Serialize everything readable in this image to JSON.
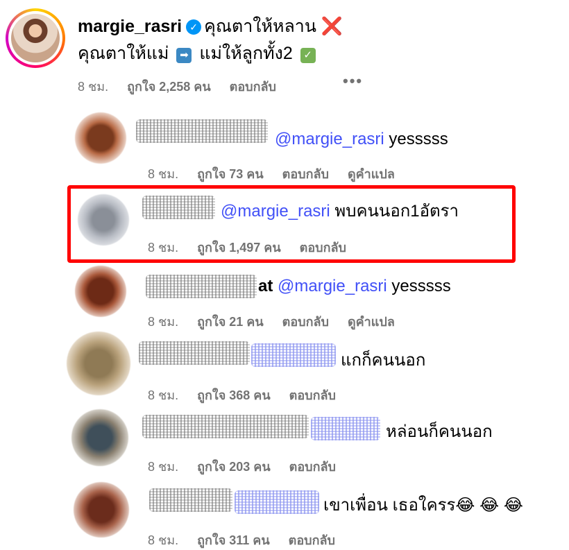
{
  "main_comment": {
    "username": "margie_rasri",
    "text_line1": "คุณตาให้หลาน",
    "line1_emoji": "❌",
    "text_line2_part1": "คุณตาให้แม่",
    "line2_arrow_emoji": "➡",
    "text_line2_part2": "แม่ให้ลูกทั้ง2",
    "line2_check_emoji": "✓",
    "time": "8 ชม.",
    "likes": "ถูกใจ 2,258 คน",
    "reply_label": "ตอบกลับ",
    "more": "•••"
  },
  "replies": [
    {
      "mention": "@margie_rasri",
      "text": "yesssss",
      "time": "8 ชม.",
      "likes": "ถูกใจ 73 คน",
      "reply_label": "ตอบกลับ",
      "translate_label": "ดูคำแปล"
    },
    {
      "mention": "@margie_rasri",
      "text": "พบคนนอก1อัตรา",
      "time": "8 ชม.",
      "likes": "ถูกใจ 1,497 คน",
      "reply_label": "ตอบกลับ",
      "highlighted": true
    },
    {
      "name_fragment": "at",
      "mention": "@margie_rasri",
      "text": "yesssss",
      "time": "8 ชม.",
      "likes": "ถูกใจ 21 คน",
      "reply_label": "ตอบกลับ",
      "translate_label": "ดูคำแปล"
    },
    {
      "text": "แกก็คนนอก",
      "time": "8 ชม.",
      "likes": "ถูกใจ 368 คน",
      "reply_label": "ตอบกลับ"
    },
    {
      "text": "หล่อนก็คนนอก",
      "time": "8 ชม.",
      "likes": "ถูกใจ 203 คน",
      "reply_label": "ตอบกลับ"
    },
    {
      "text": "เขาเพื่อน เธอใครร",
      "emoji": "😂 😂 😂",
      "time": "8 ชม.",
      "likes": "ถูกใจ 311 คน",
      "reply_label": "ตอบกลับ"
    }
  ],
  "colors": {
    "mention": "#4150f7",
    "meta_gray": "#737373",
    "highlight_border": "#ff0000",
    "verified": "#0095f6"
  }
}
